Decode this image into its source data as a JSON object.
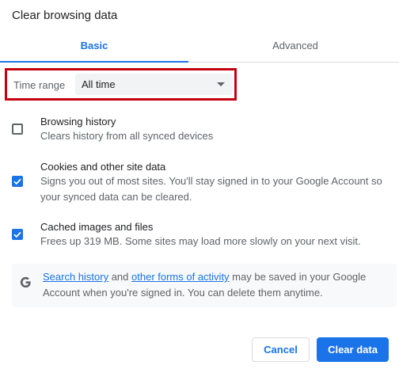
{
  "dialog": {
    "title": "Clear browsing data"
  },
  "tabs": [
    {
      "label": "Basic",
      "selected": true
    },
    {
      "label": "Advanced",
      "selected": false
    }
  ],
  "time_range": {
    "label": "Time range",
    "value": "All time"
  },
  "options": [
    {
      "title": "Browsing history",
      "description": "Clears history from all synced devices",
      "checked": false
    },
    {
      "title": "Cookies and other site data",
      "description": "Signs you out of most sites. You'll stay signed in to your Google Account so your synced data can be cleared.",
      "checked": true
    },
    {
      "title": "Cached images and files",
      "description": "Frees up 319 MB. Some sites may load more slowly on your next visit.",
      "checked": true
    }
  ],
  "info": {
    "icon": "google-g-icon",
    "link1": "Search history",
    "and": " and ",
    "link2": "other forms of activity",
    "rest": " may be saved in your Google Account when you're signed in. You can delete them anytime."
  },
  "buttons": {
    "cancel": "Cancel",
    "clear": "Clear data"
  },
  "colors": {
    "accent": "#1a73e8",
    "highlight_border": "#c5000f"
  }
}
